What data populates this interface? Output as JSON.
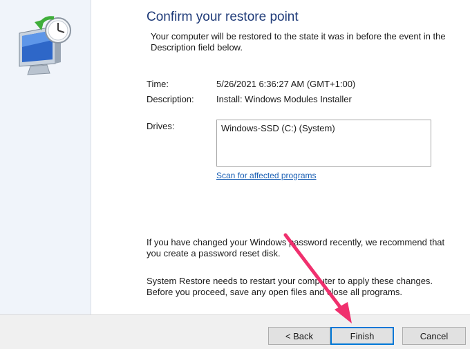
{
  "dialog": {
    "title": "Confirm your restore point",
    "intro": "Your computer will be restored to the state it was in before the event in the Description field below.",
    "fields": {
      "time_label": "Time:",
      "time_value": "5/26/2021 6:36:27 AM (GMT+1:00)",
      "description_label": "Description:",
      "description_value": "Install: Windows Modules Installer",
      "drives_label": "Drives:",
      "drives": [
        "Windows-SSD (C:) (System)"
      ]
    },
    "scan_link": "Scan for affected programs",
    "password_note": "If you have changed your Windows password recently, we recommend that you create a password reset disk.",
    "restart_note": "System Restore needs to restart your computer to apply these changes. Before you proceed, save any open files and close all programs."
  },
  "footer": {
    "back_label": "< Back",
    "finish_label": "Finish",
    "cancel_label": "Cancel"
  },
  "colors": {
    "title": "#1e3a78",
    "link": "#1a5fb4",
    "annotation_arrow": "#f0306e",
    "default_button_border": "#0078d7"
  },
  "icons": {
    "sidebar": "system-restore-icon",
    "annotation": "annotation-arrow"
  }
}
